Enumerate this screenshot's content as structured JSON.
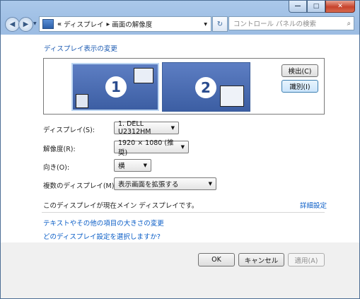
{
  "window": {
    "caption_buttons": {
      "minimize": "—",
      "maximize": "□",
      "close": "✕"
    }
  },
  "navbar": {
    "back_icon": "back-arrow-icon",
    "forward_icon": "forward-arrow-icon",
    "history_glyph": "▼",
    "path_prefix": "«",
    "crumbs": [
      "ディスプレイ",
      "画面の解像度"
    ],
    "crumb_sep": "▸",
    "dropdown_glyph": "▾",
    "refresh_glyph": "↻",
    "search_placeholder": "コントロール パネルの検索",
    "search_glyph": "⌕"
  },
  "main": {
    "heading": "ディスプレイ表示の変更",
    "monitors": [
      {
        "number": "1"
      },
      {
        "number": "2"
      }
    ],
    "detect_label": "検出(C)",
    "identify_label": "識別(I)",
    "display_label": "ディスプレイ(S):",
    "display_value": "1. DELL U2312HM",
    "resolution_label": "解像度(R):",
    "resolution_value": "1920 × 1080 (推奨)",
    "orientation_label": "向き(O):",
    "orientation_value": "横",
    "multiple_label": "複数のディスプレイ(M):",
    "multiple_value": "表示画面を拡張する",
    "status_text": "このディスプレイが現在メイン ディスプレイです。",
    "advanced_link": "詳細設定",
    "link_text_size": "テキストやその他の項目の大きさの変更",
    "link_which_settings": "どのディスプレイ設定を選択しますか?"
  },
  "footer": {
    "ok_label": "OK",
    "cancel_label": "キャンセル",
    "apply_label": "適用(A)"
  },
  "colors": {
    "link": "#0b5ec7",
    "heading": "#1e5cb3",
    "monitor": "#3c5ea3"
  }
}
